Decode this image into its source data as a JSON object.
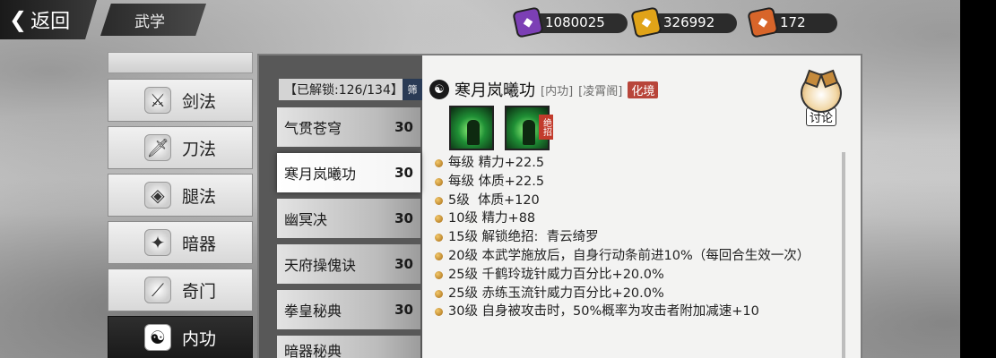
{
  "header": {
    "back_label": "返回",
    "title": "武学"
  },
  "resources": [
    {
      "icon": "purple-token-icon",
      "value": "1080025",
      "color": "#7c3fb5"
    },
    {
      "icon": "gold-token-icon",
      "value": "326992",
      "color": "#e0a318"
    },
    {
      "icon": "orange-token-icon",
      "value": "172",
      "color": "#d8652a"
    }
  ],
  "nav": {
    "items": [
      {
        "label": "剑法",
        "icon": "sword-icon"
      },
      {
        "label": "刀法",
        "icon": "blade-icon"
      },
      {
        "label": "腿法",
        "icon": "kick-icon"
      },
      {
        "label": "暗器",
        "icon": "shuriken-icon"
      },
      {
        "label": "奇门",
        "icon": "strange-weapon-icon"
      },
      {
        "label": "内功",
        "icon": "meditation-icon"
      }
    ],
    "active": "内功"
  },
  "skill_list": {
    "unlock_text": "【已解锁:126/134】",
    "filter_label": "筛",
    "items": [
      {
        "name": "气贯苍穹",
        "level": "30"
      },
      {
        "name": "寒月岚曦功",
        "level": "30"
      },
      {
        "name": "幽冥决",
        "level": "30"
      },
      {
        "name": "天府操傀诀",
        "level": "30"
      },
      {
        "name": "拳皇秘典",
        "level": "30"
      },
      {
        "name": "暗器秘典",
        "level": ""
      }
    ],
    "selected": "寒月岚曦功"
  },
  "detail": {
    "name": "寒月岚曦功",
    "type_tag": "[内功]",
    "sect_tag": "[凌霄阁]",
    "realm_tag": "化境",
    "ult_badge": "绝招",
    "effects": [
      "每级 精力+22.5",
      "每级 体质+22.5",
      "5级  体质+120",
      "10级 精力+88",
      "15级 解锁绝招:  青云绮罗",
      "20级 本武学施放后，自身行动条前进10%（每回合生效一次）",
      "25级 千鹤玲珑针威力百分比+20.0%",
      "25级 赤练玉流针威力百分比+20.0%",
      "30级 自身被攻击时，50%概率为攻击者附加减速+10"
    ]
  },
  "discuss": {
    "label": "讨论"
  }
}
